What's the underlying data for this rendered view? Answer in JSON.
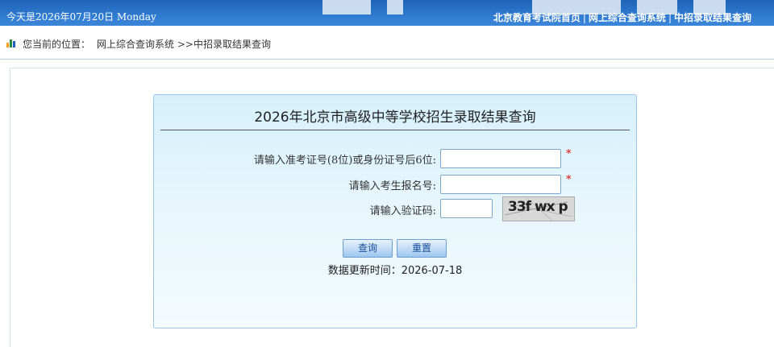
{
  "topbar": {
    "date_text": "今天是2026年07月20日 Monday",
    "links": [
      "北京教育考试院首页",
      "网上综合查询系统",
      "中招录取结果查询"
    ],
    "separator": "|"
  },
  "breadcrumb": {
    "prefix": "您当前的位置：",
    "path": "网上综合查询系统 >>中招录取结果查询"
  },
  "form": {
    "title": "2026年北京市高级中等学校招生录取结果查询",
    "fields": [
      {
        "label": "请输入准考证号(8位)或身份证号后6位:",
        "value": "",
        "required": true
      },
      {
        "label": "请输入考生报名号:",
        "value": "",
        "required": true
      },
      {
        "label": "请输入验证码:",
        "value": "",
        "required": false
      }
    ],
    "required_mark": "*",
    "captcha_text": "33f wx p",
    "buttons": {
      "query": "查询",
      "reset": "重置"
    },
    "update_label": "数据更新时间：",
    "update_date": "2026-07-18"
  },
  "colors": {
    "topbar": "#2f7bd0",
    "panel": "#e6f6fc",
    "required": "#e01010"
  }
}
